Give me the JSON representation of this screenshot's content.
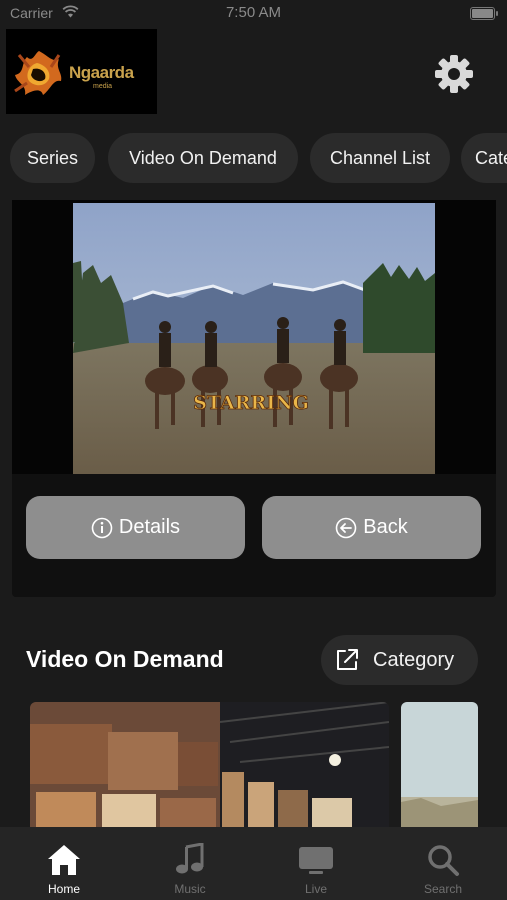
{
  "status_bar": {
    "carrier": "Carrier",
    "time": "7:50 AM"
  },
  "logo": {
    "brand": "Ngaarda",
    "sub": "media"
  },
  "tabs": [
    {
      "label": "Series"
    },
    {
      "label": "Video On Demand"
    },
    {
      "label": "Channel List"
    },
    {
      "label": "Categories"
    }
  ],
  "player": {
    "caption": "STARRING",
    "details_label": "Details",
    "back_label": "Back"
  },
  "section": {
    "title": "Video On Demand",
    "category_label": "Category"
  },
  "tab_bar": [
    {
      "label": "Home",
      "icon": "home-icon",
      "active": true
    },
    {
      "label": "Music",
      "icon": "music-icon",
      "active": false
    },
    {
      "label": "Live",
      "icon": "tv-icon",
      "active": false
    },
    {
      "label": "Search",
      "icon": "search-icon",
      "active": false
    }
  ],
  "colors": {
    "background": "#1b1b1b",
    "chip": "#2b2b2b",
    "button": "#8e8e8e",
    "tab_active": "#ffffff",
    "tab_inactive": "#707070",
    "logo_gold": "#c9a24c"
  }
}
